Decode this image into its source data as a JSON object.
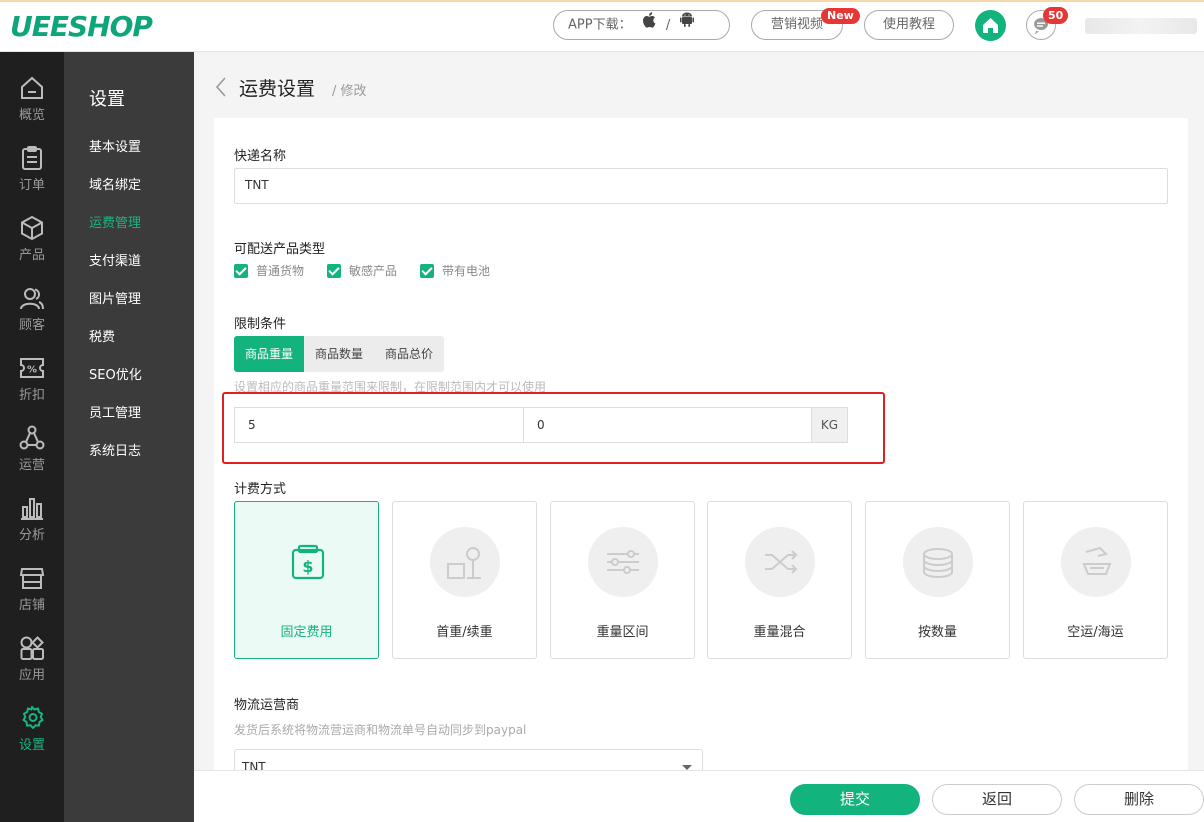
{
  "brand": {
    "logo_text": "UEESHOP",
    "accent": "#13b37e"
  },
  "header": {
    "app_download_label": "APP下载：",
    "app_separator": "/",
    "marketing_video_label": "营销视频",
    "new_badge": "New",
    "tutorial_label": "使用教程",
    "message_count": "50"
  },
  "sidebar": {
    "items": [
      {
        "label": "概览",
        "icon": "home-outline-icon"
      },
      {
        "label": "订单",
        "icon": "clipboard-icon"
      },
      {
        "label": "产品",
        "icon": "box-icon"
      },
      {
        "label": "顾客",
        "icon": "users-icon"
      },
      {
        "label": "折扣",
        "icon": "percent-tag-icon"
      },
      {
        "label": "运营",
        "icon": "network-icon"
      },
      {
        "label": "分析",
        "icon": "bar-chart-icon"
      },
      {
        "label": "店铺",
        "icon": "store-icon"
      },
      {
        "label": "应用",
        "icon": "apps-icon"
      },
      {
        "label": "设置",
        "icon": "gear-icon"
      }
    ]
  },
  "submenu": {
    "title": "设置",
    "items": [
      "基本设置",
      "域名绑定",
      "运费管理",
      "支付渠道",
      "图片管理",
      "税费",
      "SEO优化",
      "员工管理",
      "系统日志"
    ]
  },
  "page": {
    "title": "运费设置",
    "subtitle": "/ 修改"
  },
  "form": {
    "express_name_label": "快递名称",
    "express_name_value": "TNT",
    "product_types_label": "可配送产品类型",
    "product_types": [
      "普通货物",
      "敏感产品",
      "带有电池"
    ],
    "limit_label": "限制条件",
    "limit_tabs": [
      "商品重量",
      "商品数量",
      "商品总价"
    ],
    "limit_hint": "设置相应的商品重量范围来限制，在限制范围内才可以使用",
    "range_min": "5",
    "range_max": "0",
    "range_unit": "KG",
    "billing_label": "计费方式",
    "billing_methods": [
      "固定费用",
      "首重/续重",
      "重量区间",
      "重量混合",
      "按数量",
      "空运/海运"
    ],
    "carrier_label": "物流运营商",
    "carrier_hint": "发货后系统将物流营运商和物流单号自动同步到paypal",
    "carrier_value": "TNT"
  },
  "footer": {
    "submit": "提交",
    "back": "返回",
    "delete": "删除"
  }
}
